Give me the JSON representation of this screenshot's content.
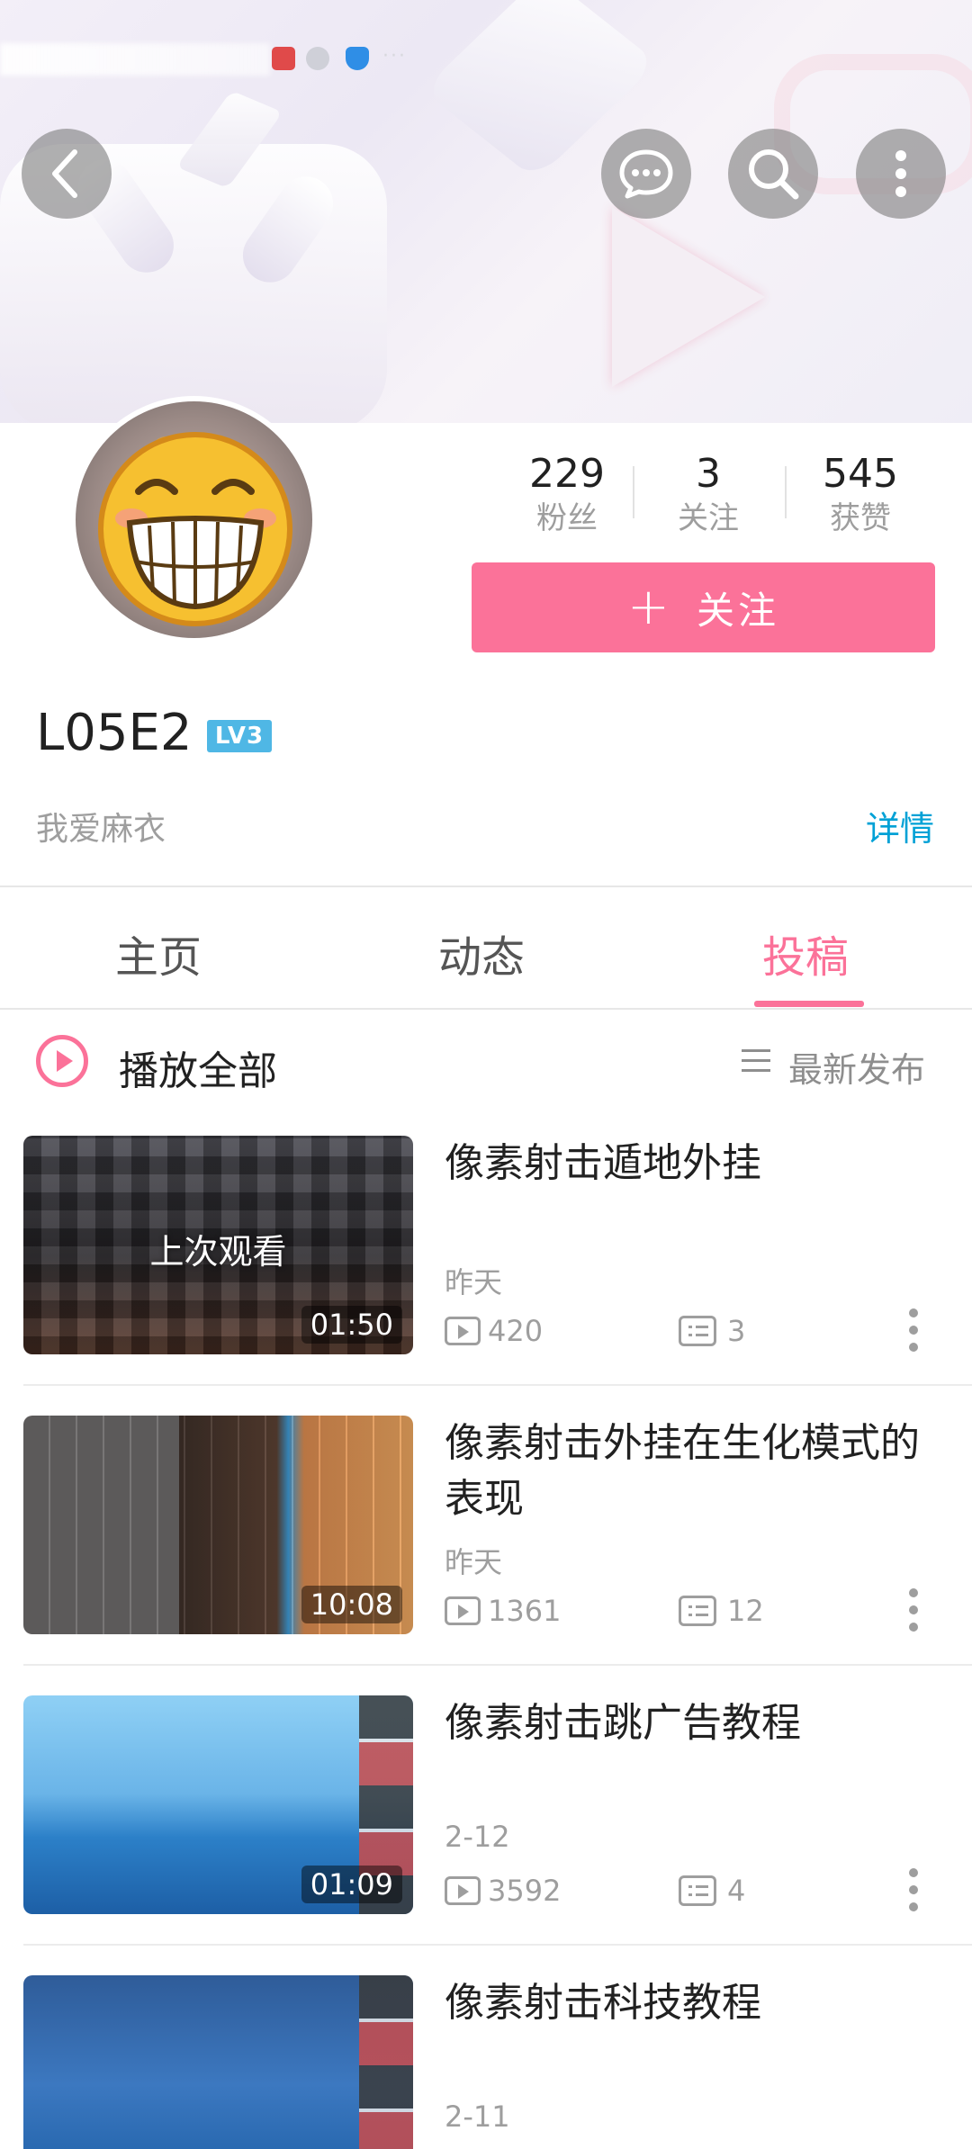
{
  "status": {
    "icons": [
      "book-icon",
      "gray-app-icon",
      "shield-icon"
    ],
    "more": "···"
  },
  "header": {
    "back_icon": "chevron-left-icon",
    "message_icon": "chat-bubble-icon",
    "search_icon": "search-icon",
    "more_icon": "more-vertical-icon"
  },
  "profile": {
    "stats": [
      {
        "value": "229",
        "label": "粉丝"
      },
      {
        "value": "3",
        "label": "关注"
      },
      {
        "value": "545",
        "label": "获赞"
      }
    ],
    "follow_plus": "+",
    "follow_label": "关注",
    "username": "L05E2",
    "level": "LV3",
    "signature": "我爱麻衣",
    "detail_link": "详情"
  },
  "tabs": [
    {
      "label": "主页",
      "active": false
    },
    {
      "label": "动态",
      "active": false
    },
    {
      "label": "投稿",
      "active": true
    }
  ],
  "playbar": {
    "play_all": "播放全部",
    "sort": "最新发布"
  },
  "videos": [
    {
      "title": "像素射击遁地外挂",
      "overlay": "上次观看",
      "duration": "01:50",
      "date": "昨天",
      "plays": "420",
      "comments": "3"
    },
    {
      "title": "像素射击外挂在生化模式的表现",
      "overlay": "",
      "duration": "10:08",
      "date": "昨天",
      "plays": "1361",
      "comments": "12"
    },
    {
      "title": "像素射击跳广告教程",
      "overlay": "",
      "duration": "01:09",
      "date": "2-12",
      "plays": "3592",
      "comments": "4"
    },
    {
      "title": "像素射击科技教程",
      "overlay": "",
      "duration": "",
      "date": "2-11",
      "plays": "",
      "comments": ""
    }
  ],
  "colors": {
    "accent": "#fb7299",
    "link": "#00a1d6",
    "level": "#4fb7e5"
  }
}
